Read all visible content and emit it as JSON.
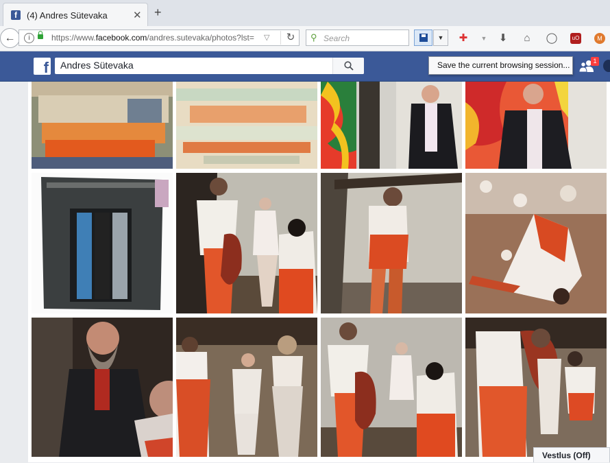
{
  "browser": {
    "tab_title": "(4) Andres Sütevaka",
    "tab_favicon": "facebook-favicon",
    "new_tab_label": "+",
    "url_prefix": "https://www.",
    "url_domain": "facebook.com",
    "url_path": "/andres.sutevaka/photos?lst=",
    "search_placeholder": "Search",
    "tooltip": "Save the current browsing session..."
  },
  "facebook": {
    "search_value": "Andres Sütevaka",
    "friend_requests_count": "1",
    "brand_color": "#3b5998"
  },
  "photos": [
    {
      "id": "photo-1",
      "alt": "abstract painting red white"
    },
    {
      "id": "photo-2",
      "alt": "abstract painting orange pale"
    },
    {
      "id": "photo-3",
      "alt": "man in front of colorful painting"
    },
    {
      "id": "photo-4",
      "alt": "man in dark jacket before painting"
    },
    {
      "id": "photo-5",
      "alt": "dark window object blue"
    },
    {
      "id": "photo-6",
      "alt": "performance bloody figures"
    },
    {
      "id": "photo-7",
      "alt": "performer carrying beam"
    },
    {
      "id": "photo-8",
      "alt": "figure lying on floor"
    },
    {
      "id": "photo-9",
      "alt": "bearded man laughing"
    },
    {
      "id": "photo-10",
      "alt": "performance group"
    },
    {
      "id": "photo-11",
      "alt": "performance bloody figures 2"
    },
    {
      "id": "photo-12",
      "alt": "performance figures 3"
    }
  ],
  "chat": {
    "label": "Vestlus (Off)"
  }
}
